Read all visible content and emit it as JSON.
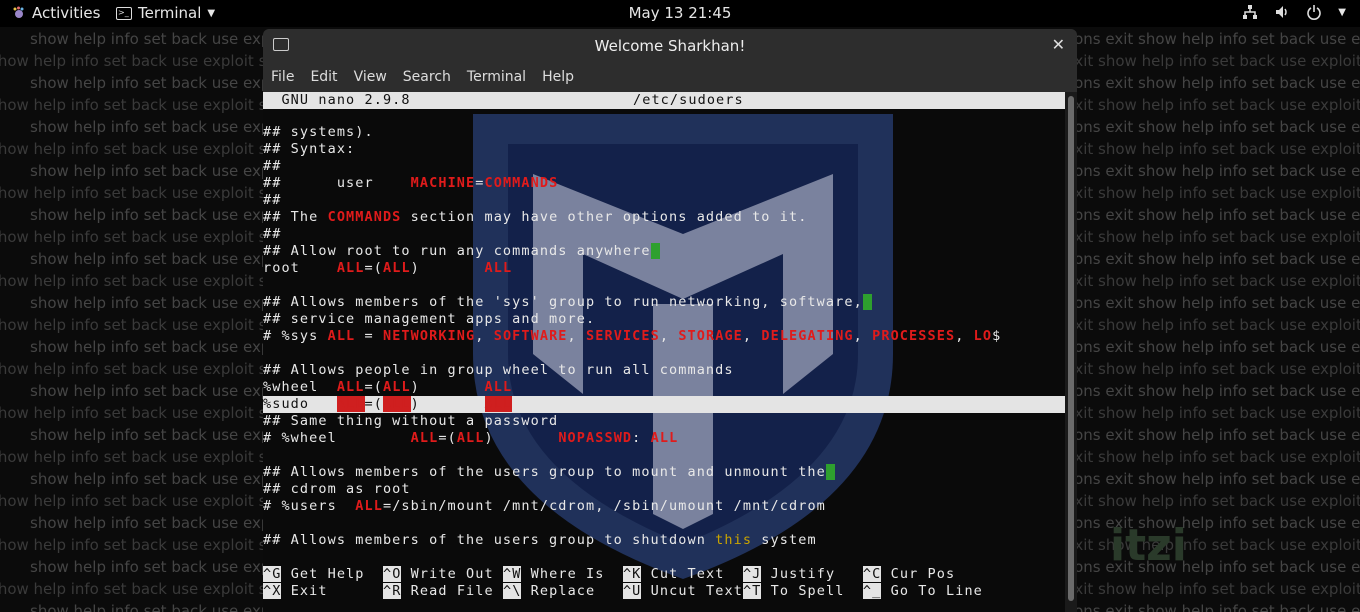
{
  "topbar": {
    "activities": "Activities",
    "app_name": "Terminal",
    "clock": "May 13  21:45",
    "icons": [
      "network-icon",
      "volume-icon",
      "power-icon"
    ]
  },
  "window": {
    "title": "Welcome Sharkhan!",
    "menu": [
      "File",
      "Edit",
      "View",
      "Search",
      "Terminal",
      "Help"
    ]
  },
  "nano": {
    "version": "  GNU nano 2.9.8",
    "filename": "/etc/sudoers",
    "lines": {
      "l1": "## systems).",
      "l2": "## Syntax:",
      "l3": "##",
      "l4a": "##      user    ",
      "l4b": "MACHINE",
      "l4c": "=",
      "l4d": "COMMANDS",
      "l5": "##",
      "l6a": "## The ",
      "l6b": "COMMANDS",
      "l6c": " section may have other options added to it.",
      "l7": "##",
      "l8": "## Allow root to run any commands anywhere",
      "l9a": "root    ",
      "l9b": "ALL",
      "l9c": "=(",
      "l9d": "ALL",
      "l9e": ")       ",
      "l9f": "ALL",
      "l10": "",
      "l11": "## Allows members of the 'sys' group to run networking, software,",
      "l12": "## service management apps and more.",
      "l13a": "# %sys ",
      "l13b": "ALL",
      "l13c": " = ",
      "l13d": "NETWORKING",
      "l13e": ", ",
      "l13f": "SOFTWARE",
      "l13g": ", ",
      "l13h": "SERVICES",
      "l13i": ", ",
      "l13j": "STORAGE",
      "l13k": ", ",
      "l13l": "DELEGATING",
      "l13m": ", ",
      "l13n": "PROCESSES",
      "l13o": ", ",
      "l13p": "LO",
      "l13q": "$",
      "l14": "",
      "l15": "## Allows people in group wheel to run all commands",
      "l16a": "%wheel  ",
      "l16b": "ALL",
      "l16c": "=(",
      "l16d": "ALL",
      "l16e": ")       ",
      "l16f": "ALL",
      "l17a": "%sudo   ",
      "l17b": "ALL",
      "l17c": "=(",
      "l17d": "ALL",
      "l17e": ")       ",
      "l17f": "ALL",
      "l18": "## Same thing without a password",
      "l19a": "# %wheel        ",
      "l19b": "ALL",
      "l19c": "=(",
      "l19d": "ALL",
      "l19e": ")       ",
      "l19f": "NOPASSWD",
      "l19g": ": ",
      "l19h": "ALL",
      "l20": "",
      "l21": "## Allows members of the users group to mount and unmount the",
      "l22": "## cdrom as root",
      "l23a": "# %users  ",
      "l23b": "ALL",
      "l23c": "=/sbin/mount /mnt/cdrom, /sbin/umount /mnt/cdrom",
      "l24": "",
      "l25a": "## Allows members of the users group to shutdown ",
      "l25b": "this",
      "l25c": " system"
    },
    "shortcuts": [
      {
        "key": "^G",
        "label": " Get Help  "
      },
      {
        "key": "^O",
        "label": " Write Out "
      },
      {
        "key": "^W",
        "label": " Where Is  "
      },
      {
        "key": "^K",
        "label": " Cut Text  "
      },
      {
        "key": "^J",
        "label": " Justify   "
      },
      {
        "key": "^C",
        "label": " Cur Pos"
      },
      {
        "key": "^X",
        "label": " Exit      "
      },
      {
        "key": "^R",
        "label": " Read File "
      },
      {
        "key": "^\\",
        "label": " Replace   "
      },
      {
        "key": "^U",
        "label": " Uncut Text"
      },
      {
        "key": "^T",
        "label": " To Spell  "
      },
      {
        "key": "^_",
        "label": " Go To Line"
      }
    ]
  },
  "background": {
    "words": "show help info set back use exploit sessions exit show help info set back use exploit sessions exit show help info set back use exploit sessions exit show help info set back use exploit sessions exit",
    "logo": "itzi"
  }
}
